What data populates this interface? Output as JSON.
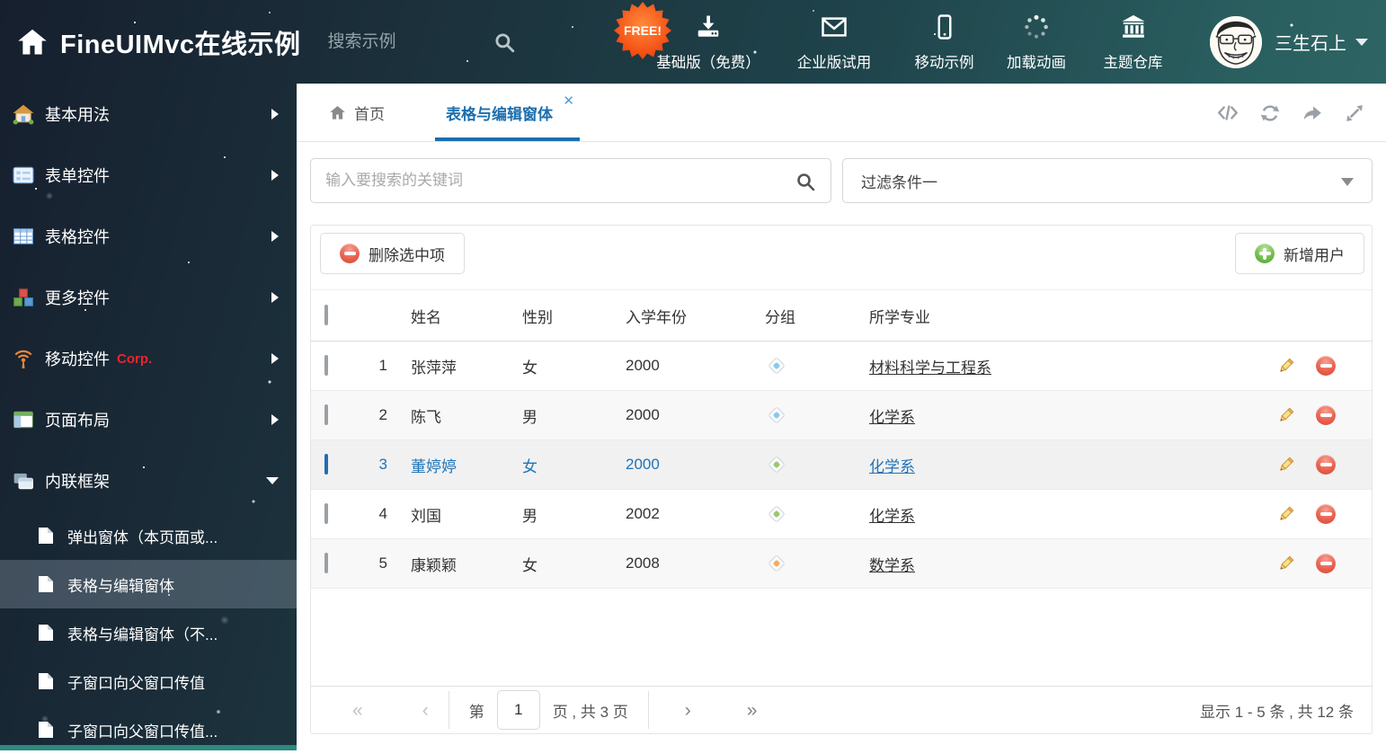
{
  "colors": {
    "accent": "#1b6eae",
    "selected_row_text": "#1f74b8",
    "tag_blue": "#8cc8f0",
    "tag_green": "#97c96e",
    "tag_orange": "#f5aa64",
    "corp_red": "#e8262d",
    "free_badge_orange": "#f84c10"
  },
  "header": {
    "title": "FineUIMvc在线示例",
    "search_placeholder": "搜索示例",
    "free_badge": "FREE!",
    "nav": [
      {
        "icon": "download-icon",
        "label": "基础版（免费）"
      },
      {
        "icon": "envelope-icon",
        "label": "企业版试用"
      },
      {
        "icon": "mobile-icon",
        "label": "移动示例"
      },
      {
        "icon": "spinner-icon",
        "label": "加载动画"
      },
      {
        "icon": "bank-icon",
        "label": "主题仓库"
      }
    ],
    "username": "三生石上"
  },
  "sidebar": {
    "items": [
      {
        "label": "基本用法",
        "icon": "home-icon"
      },
      {
        "label": "表单控件",
        "icon": "form-icon"
      },
      {
        "label": "表格控件",
        "icon": "table-icon"
      },
      {
        "label": "更多控件",
        "icon": "cubes-icon"
      },
      {
        "label": "移动控件",
        "badge": "Corp.",
        "icon": "signal-icon"
      },
      {
        "label": "页面布局",
        "icon": "layout-icon"
      },
      {
        "label": "内联框架",
        "icon": "frames-icon"
      }
    ],
    "subitems": [
      {
        "label": "弹出窗体（本页面或..."
      },
      {
        "label": "表格与编辑窗体"
      },
      {
        "label": "表格与编辑窗体（不..."
      },
      {
        "label": "子窗口向父窗口传值"
      },
      {
        "label": "子窗口向父窗口传值..."
      }
    ]
  },
  "tabs": {
    "home": "首页",
    "active": "表格与编辑窗体"
  },
  "filter": {
    "search_placeholder": "输入要搜索的关键词",
    "dropdown_value": "过滤条件一"
  },
  "toolbar": {
    "delete_label": "删除选中项",
    "add_label": "新增用户"
  },
  "table": {
    "columns": [
      "姓名",
      "性别",
      "入学年份",
      "分组",
      "所学专业"
    ],
    "rows": [
      {
        "num": "1",
        "name": "张萍萍",
        "gender": "女",
        "year": "2000",
        "tag_style": "background:#8cc8f0",
        "major": "材料科学与工程系"
      },
      {
        "num": "2",
        "name": "陈飞",
        "gender": "男",
        "year": "2000",
        "tag_style": "background:#8cc8f0",
        "major": "化学系"
      },
      {
        "num": "3",
        "name": "董婷婷",
        "gender": "女",
        "year": "2000",
        "tag_style": "background:#97c96e",
        "major": "化学系"
      },
      {
        "num": "4",
        "name": "刘国",
        "gender": "男",
        "year": "2002",
        "tag_style": "background:#97c96e",
        "major": "化学系"
      },
      {
        "num": "5",
        "name": "康颖颖",
        "gender": "女",
        "year": "2008",
        "tag_style": "background:#f5aa64",
        "major": "数学系"
      }
    ]
  },
  "pagination": {
    "page_prefix": "第",
    "page_value": "1",
    "page_suffix": "页 , 共 3 页",
    "summary": "显示 1 - 5 条 , 共 12 条"
  }
}
